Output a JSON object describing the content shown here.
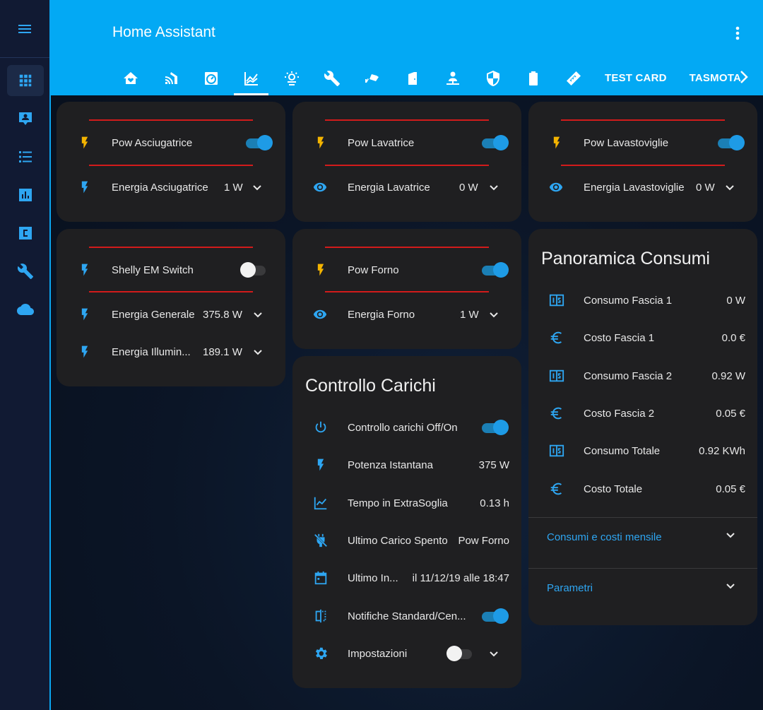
{
  "app": {
    "title": "Home Assistant"
  },
  "colors": {
    "accent": "#03a9f4",
    "icon": "#2ea6f2",
    "bolt_yellow": "#f4b400",
    "divider_red": "#d21b1b",
    "card": "#1f1f21"
  },
  "sidebar": {
    "menu_icon": "menu-icon",
    "items": [
      {
        "icon": "grid-icon",
        "active": true
      },
      {
        "icon": "account-box-icon"
      },
      {
        "icon": "format-list-icon"
      },
      {
        "icon": "chart-box-icon"
      },
      {
        "icon": "alpha-c-box-icon"
      },
      {
        "icon": "wrench-icon"
      },
      {
        "icon": "cloud-icon"
      }
    ]
  },
  "tabs": {
    "icons": [
      "home-heart-icon",
      "home-wifi-icon",
      "speedometer-icon",
      "chart-line-icon",
      "weather-icon",
      "wrench-icon",
      "cctv-icon",
      "door-icon",
      "account-network-icon",
      "shield-icon",
      "battery-icon",
      "ruler-icon"
    ],
    "text_tabs": [
      "TEST CARD",
      "TASMOTA"
    ]
  },
  "card_asciugatrice": {
    "rows": [
      {
        "label": "Pow Asciugatrice",
        "icon": "flash-icon"
      },
      {
        "label": "Energia Asciugatrice",
        "value": "1 W",
        "icon": "flash-icon"
      }
    ]
  },
  "card_lavatrice": {
    "rows": [
      {
        "label": "Pow Lavatrice",
        "icon": "flash-icon"
      },
      {
        "label": "Energia Lavatrice",
        "value": "0 W",
        "icon": "eye-icon"
      }
    ]
  },
  "card_lavastoviglie": {
    "rows": [
      {
        "label": "Pow Lavastoviglie",
        "icon": "flash-icon"
      },
      {
        "label": "Energia Lavastoviglie",
        "value": "0 W",
        "icon": "eye-icon"
      }
    ]
  },
  "card_shelly": {
    "rows": [
      {
        "label": "Shelly EM Switch",
        "icon": "flash-icon"
      },
      {
        "label": "Energia Generale",
        "value": "375.8 W",
        "icon": "flash-icon"
      },
      {
        "label": "Energia Illumin...",
        "value": "189.1 W",
        "icon": "flash-icon"
      }
    ]
  },
  "card_forno": {
    "rows": [
      {
        "label": "Pow Forno",
        "icon": "flash-icon"
      },
      {
        "label": "Energia Forno",
        "value": "1 W",
        "icon": "eye-icon"
      }
    ]
  },
  "card_controllo": {
    "title": "Controllo Carichi",
    "rows": [
      {
        "label": "Controllo carichi Off/On",
        "icon": "power-icon"
      },
      {
        "label": "Potenza Istantana",
        "value": "375 W",
        "icon": "flash-icon"
      },
      {
        "label": "Tempo in ExtraSoglia",
        "value": "0.13 h",
        "icon": "chart-line-icon"
      },
      {
        "label": "Ultimo Carico Spento",
        "value": "Pow Forno",
        "icon": "power-plug-off-icon"
      },
      {
        "label": "Ultimo In...",
        "value": "il 11/12/19 alle 18:47",
        "icon": "calendar-icon"
      },
      {
        "label": "Notifiche Standard/Cen...",
        "icon": "compare-icon"
      },
      {
        "label": "Impostazioni",
        "icon": "cog-icon"
      }
    ]
  },
  "card_panoramica": {
    "title": "Panoramica Consumi",
    "rows": [
      {
        "label": "Consumo Fascia 1",
        "value": "0 W",
        "icon": "numeric-1-box-icon"
      },
      {
        "label": "Costo Fascia 1",
        "value": "0.0 €",
        "icon": "currency-eur-icon"
      },
      {
        "label": "Consumo Fascia 2",
        "value": "0.92 W",
        "icon": "numeric-1-box-icon"
      },
      {
        "label": "Costo Fascia 2",
        "value": "0.05 €",
        "icon": "currency-eur-icon"
      },
      {
        "label": "Consumo Totale",
        "value": "0.92 KWh",
        "icon": "numeric-1-box-icon"
      },
      {
        "label": "Costo Totale",
        "value": "0.05 €",
        "icon": "currency-eur-icon"
      }
    ],
    "expanders": [
      "Consumi e costi mensile",
      "Parametri"
    ]
  }
}
